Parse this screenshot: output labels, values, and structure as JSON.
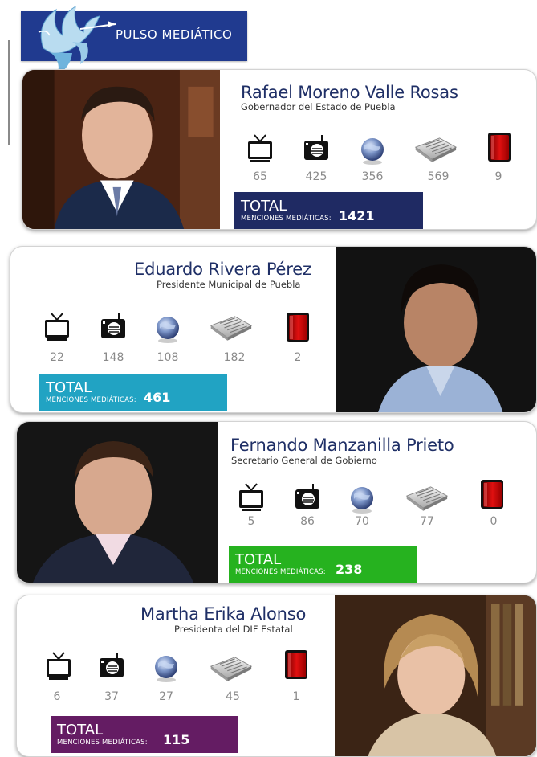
{
  "header": {
    "brand": "PULSO MEDIÁTICO"
  },
  "total_label": "TOTAL",
  "total_sub": "MENCIONES MEDIÁTICAS:",
  "icons": [
    "tv-icon",
    "radio-icon",
    "internet-globe-icon",
    "newspaper-icon",
    "magazine-icon"
  ],
  "colors": {
    "header_bg": "#203a8f",
    "name_text": "#1f2f66",
    "count_text": "#8a8a8a",
    "total_card1": "#1f2a63",
    "total_card2": "#21a3c3",
    "total_card3": "#26b21f",
    "total_card4": "#641c63"
  },
  "cards": [
    {
      "name": "Rafael Moreno Valle Rosas",
      "role": "Gobernador del Estado de Puebla",
      "counts": [
        "65",
        "425",
        "356",
        "569",
        "9"
      ],
      "total": "1421"
    },
    {
      "name": "Eduardo Rivera Pérez",
      "role": "Presidente Municipal de Puebla",
      "counts": [
        "22",
        "148",
        "108",
        "182",
        "2"
      ],
      "total": "461"
    },
    {
      "name": "Fernando Manzanilla Prieto",
      "role": "Secretario General de Gobierno",
      "counts": [
        "5",
        "86",
        "70",
        "77",
        "0"
      ],
      "total": "238"
    },
    {
      "name": "Martha Erika Alonso",
      "role": "Presidenta del DIF Estatal",
      "counts": [
        "6",
        "37",
        "27",
        "45",
        "1"
      ],
      "total": "115"
    }
  ]
}
